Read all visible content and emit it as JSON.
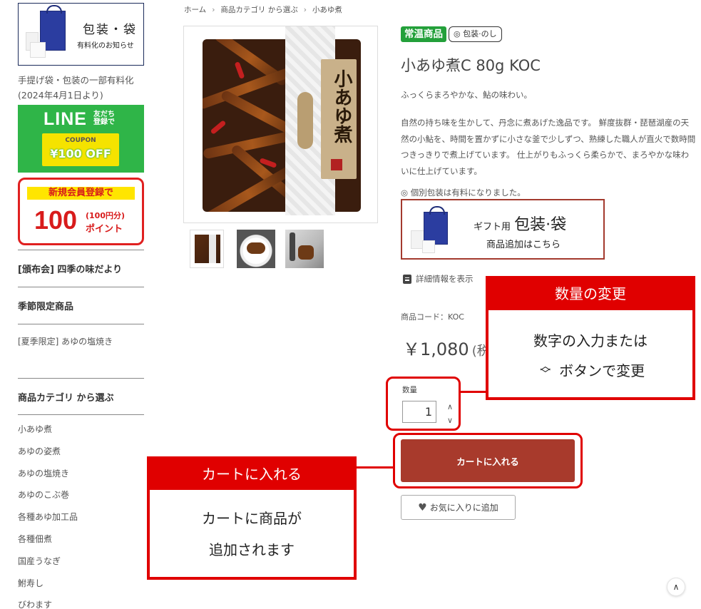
{
  "sidebar": {
    "wrapping_banner": {
      "title": "包装・袋",
      "subtitle": "有料化のお知らせ"
    },
    "note": "手提げ袋・包装の一部有料化(2024年4月1日より)",
    "line_banner": {
      "main": "LINE",
      "side": "友だち登録で",
      "coupon_label": "COUPON",
      "coupon_value": "¥100 OFF"
    },
    "point_banner": {
      "top": "新規会員登録で",
      "num": "100",
      "sub1": "(100円分)",
      "sub2": "ポイント"
    },
    "menu_1": "[頒布会] 四季の味だより",
    "menu_2": "季節限定商品",
    "menu_2_link": "[夏季限定] あゆの塩焼き",
    "category_heading": "商品カテゴリ から選ぶ",
    "categories": [
      "小あゆ煮",
      "あゆの姿煮",
      "あゆの塩焼き",
      "あゆのこぶ巻",
      "各種あゆ加工品",
      "各種佃煮",
      "国産うなぎ",
      "鮒寿し",
      "びわます"
    ]
  },
  "breadcrumb": [
    "ホーム",
    "商品カテゴリ から選ぶ",
    "小あゆ煮"
  ],
  "product": {
    "package_label": "小あゆ煮",
    "badges": [
      "常温商品",
      "◎ 包装·のし"
    ],
    "name": "小あゆ煮C 80g KOC",
    "lead": "ふっくらまろやかな、鮎の味わい。",
    "description": "自然の持ち味を生かして、丹念に煮あげた逸品です。 鮮度抜群・琵琶湖産の天然の小鮎を、時間を置かずに小さな釜で少しずつ、熟練した職人が直火で数時間つきっきりで煮上げています。 仕上がりもふっくら柔らかで、まろやかな味わいに仕上げています。",
    "note": "◎ 個別包装は有料になりました。",
    "gift_banner": {
      "line1_small": "ギフト用",
      "line1_large": "包装·袋",
      "line2": "商品追加はこちら"
    },
    "detail_link": "詳細情報を表示",
    "code": "商品コード：KOC",
    "price": "￥1,080",
    "price_suffix": "(税",
    "quantity_label": "数量",
    "quantity": "1",
    "cart_button": "カートに入れる",
    "favorite_button": "お気に入りに追加"
  },
  "callouts": {
    "qty": {
      "title": "数量の変更",
      "line1": "数字の入力または",
      "line2": "ボタンで変更"
    },
    "cart": {
      "title": "カートに入れる",
      "line1": "カートに商品が",
      "line2": "追加されます"
    }
  },
  "colors": {
    "accent_red": "#e00000",
    "cart_button": "#a83a2c",
    "badge_green": "#23a03a",
    "line_green": "#2fb548"
  },
  "icons": [
    "scroll-top-icon",
    "heart-icon",
    "document-icon",
    "chevron-up-icon",
    "chevron-down-icon"
  ]
}
